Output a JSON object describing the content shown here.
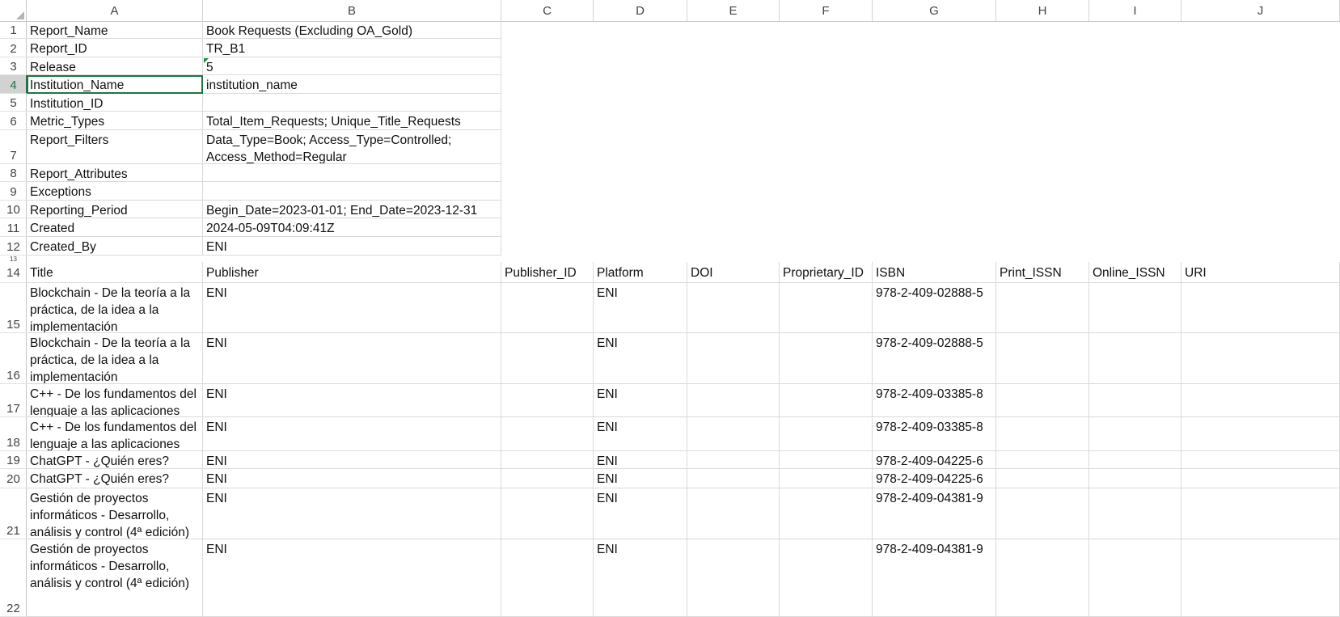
{
  "columns": [
    "A",
    "B",
    "C",
    "D",
    "E",
    "F",
    "G",
    "H",
    "I",
    "J"
  ],
  "metadata_rows": [
    {
      "row": "1",
      "key": "Report_Name",
      "value": "Book Requests (Excluding OA_Gold)"
    },
    {
      "row": "2",
      "key": "Report_ID",
      "value": "TR_B1"
    },
    {
      "row": "3",
      "key": "Release",
      "value": "5"
    },
    {
      "row": "4",
      "key": "Institution_Name",
      "value": "institution_name"
    },
    {
      "row": "5",
      "key": "Institution_ID",
      "value": ""
    },
    {
      "row": "6",
      "key": "Metric_Types",
      "value": "Total_Item_Requests; Unique_Title_Requests"
    },
    {
      "row": "7",
      "key": "Report_Filters",
      "value": "Data_Type=Book; Access_Type=Controlled; Access_Method=Regular"
    },
    {
      "row": "8",
      "key": "Report_Attributes",
      "value": ""
    },
    {
      "row": "9",
      "key": "Exceptions",
      "value": ""
    },
    {
      "row": "10",
      "key": "Reporting_Period",
      "value": "Begin_Date=2023-01-01; End_Date=2023-12-31"
    },
    {
      "row": "11",
      "key": "Created",
      "value": "2024-05-09T04:09:41Z"
    },
    {
      "row": "12",
      "key": "Created_By",
      "value": "ENI"
    }
  ],
  "hidden_row": "13",
  "header_row": {
    "row": "14",
    "cells": [
      "Title",
      "Publisher",
      "Publisher_ID",
      "Platform",
      "DOI",
      "Proprietary_ID",
      "ISBN",
      "Print_ISSN",
      "Online_ISSN",
      "URI"
    ]
  },
  "data_rows": [
    {
      "row": "15",
      "title": "Blockchain - De la teoría a la práctica, de la idea a la implementación",
      "publisher": "ENI",
      "publisher_id": "",
      "platform": "ENI",
      "doi": "",
      "proprietary_id": "",
      "isbn": "978-2-409-02888-5",
      "print_issn": "",
      "online_issn": "",
      "uri": ""
    },
    {
      "row": "16",
      "title": "Blockchain - De la teoría a la práctica, de la idea a la implementación",
      "publisher": "ENI",
      "publisher_id": "",
      "platform": "ENI",
      "doi": "",
      "proprietary_id": "",
      "isbn": "978-2-409-02888-5",
      "print_issn": "",
      "online_issn": "",
      "uri": ""
    },
    {
      "row": "17",
      "title": "C++ - De los fundamentos del lenguaje a las aplicaciones",
      "publisher": "ENI",
      "publisher_id": "",
      "platform": "ENI",
      "doi": "",
      "proprietary_id": "",
      "isbn": "978-2-409-03385-8",
      "print_issn": "",
      "online_issn": "",
      "uri": ""
    },
    {
      "row": "18",
      "title": "C++ - De los fundamentos del lenguaje a las aplicaciones",
      "publisher": "ENI",
      "publisher_id": "",
      "platform": "ENI",
      "doi": "",
      "proprietary_id": "",
      "isbn": "978-2-409-03385-8",
      "print_issn": "",
      "online_issn": "",
      "uri": ""
    },
    {
      "row": "19",
      "title": "ChatGPT - ¿Quién eres?",
      "publisher": "ENI",
      "publisher_id": "",
      "platform": "ENI",
      "doi": "",
      "proprietary_id": "",
      "isbn": "978-2-409-04225-6",
      "print_issn": "",
      "online_issn": "",
      "uri": ""
    },
    {
      "row": "20",
      "title": "ChatGPT - ¿Quién eres?",
      "publisher": "ENI",
      "publisher_id": "",
      "platform": "ENI",
      "doi": "",
      "proprietary_id": "",
      "isbn": "978-2-409-04225-6",
      "print_issn": "",
      "online_issn": "",
      "uri": ""
    },
    {
      "row": "21",
      "title": "Gestión de proyectos informáticos - Desarrollo, análisis y control (4ª edición)",
      "publisher": "ENI",
      "publisher_id": "",
      "platform": "ENI",
      "doi": "",
      "proprietary_id": "",
      "isbn": "978-2-409-04381-9",
      "print_issn": "",
      "online_issn": "",
      "uri": ""
    },
    {
      "row": "22",
      "title": "Gestión de proyectos informáticos - Desarrollo, análisis y control (4ª edición)",
      "publisher": "ENI",
      "publisher_id": "",
      "platform": "ENI",
      "doi": "",
      "proprietary_id": "",
      "isbn": "978-2-409-04381-9",
      "print_issn": "",
      "online_issn": "",
      "uri": ""
    }
  ],
  "selection": {
    "active_cell": "A4",
    "active_row": "4",
    "active_column": "A"
  },
  "colors": {
    "selection_accent": "#217346",
    "selected_header_bg": "#d2d2d2",
    "gridline": "#dadada",
    "error_indicator": "#1f8a3c"
  }
}
